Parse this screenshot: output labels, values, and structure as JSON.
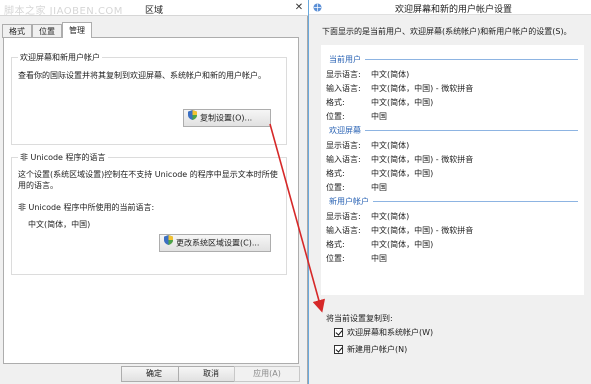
{
  "region_window": {
    "title": "区域",
    "watermark": "脚本之家 JIAOBEN.COM",
    "close_glyph": "✕",
    "tabs": [
      {
        "label": "格式",
        "active": false
      },
      {
        "label": "位置",
        "active": false
      },
      {
        "label": "管理",
        "active": true
      }
    ],
    "welcome_group": {
      "label": "欢迎屏幕和新用户帐户",
      "text": "查看你的国际设置并将其复制到欢迎屏幕、系统帐户和新的用户帐户。",
      "button": "复制设置(O)..."
    },
    "unicode_group": {
      "label": "非 Unicode 程序的语言",
      "text_line1": "这个设置(系统区域设置)控制在不支持 Unicode 的程序中显示文本时所使",
      "text_line2": "用的语言。",
      "current_label": "非 Unicode 程序中所使用的当前语言:",
      "current_value": "中文(简体，中国)",
      "button": "更改系统区域设置(C)..."
    },
    "footer": {
      "ok": "确定",
      "cancel": "取消",
      "apply": "应用(A)"
    }
  },
  "settings_window": {
    "title": "欢迎屏幕和新的用户帐户设置",
    "description": "下面显示的是当前用户、欢迎屏幕(系统帐户)和新用户帐户的设置(S)。",
    "sections": [
      {
        "title": "当前用户",
        "rows": [
          {
            "key": "显示语言:",
            "value": "中文(简体)"
          },
          {
            "key": "输入语言:",
            "value": "中文(简体，中国) - 微软拼音"
          },
          {
            "key": "格式:",
            "value": "中文(简体，中国)"
          },
          {
            "key": "位置:",
            "value": "中国"
          }
        ]
      },
      {
        "title": "欢迎屏幕",
        "rows": [
          {
            "key": "显示语言:",
            "value": "中文(简体)"
          },
          {
            "key": "输入语言:",
            "value": "中文(简体，中国) - 微软拼音"
          },
          {
            "key": "格式:",
            "value": "中文(简体，中国)"
          },
          {
            "key": "位置:",
            "value": "中国"
          }
        ]
      },
      {
        "title": "新用户帐户",
        "rows": [
          {
            "key": "显示语言:",
            "value": "中文(简体)"
          },
          {
            "key": "输入语言:",
            "value": "中文(简体，中国) - 微软拼音"
          },
          {
            "key": "格式:",
            "value": "中文(简体，中国)"
          },
          {
            "key": "位置:",
            "value": "中国"
          }
        ]
      }
    ],
    "copy_to_label": "将当前设置复制到:",
    "checkboxes": [
      {
        "label": "欢迎屏幕和系统帐户(W)",
        "checked": true
      },
      {
        "label": "新建用户帐户(N)",
        "checked": true
      }
    ]
  },
  "colors": {
    "section_title": "#2a63b4",
    "annotation_arrow": "#d62828"
  }
}
